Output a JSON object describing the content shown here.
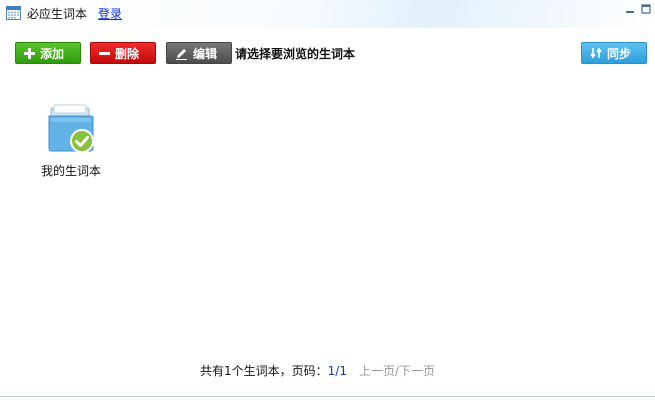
{
  "titlebar": {
    "title": "必应生词本",
    "login_label": "登录",
    "icons": {
      "app": "calendar-icon",
      "minimize": "minimize-icon",
      "maximize": "maximize-icon"
    }
  },
  "toolbar": {
    "add_label": "添加",
    "delete_label": "删除",
    "edit_label": "编辑",
    "hint": "请选择要浏览的生词本",
    "sync_label": "同步",
    "icons": {
      "add": "plus-icon",
      "delete": "minus-icon",
      "edit": "pencil-icon",
      "sync": "sync-arrows-icon"
    }
  },
  "wordbooks": [
    {
      "label": "我的生词本",
      "icon": "folder-check-icon"
    }
  ],
  "footer": {
    "summary": "共有1个生词本，页码：",
    "page": "1/1",
    "prev_label": "上一页",
    "separator": "/",
    "next_label": "下一页"
  },
  "colors": {
    "add": "#3fae17",
    "delete": "#d71616",
    "edit": "#5f5f5f",
    "sync": "#42afe6",
    "link": "#0a2ee0"
  }
}
